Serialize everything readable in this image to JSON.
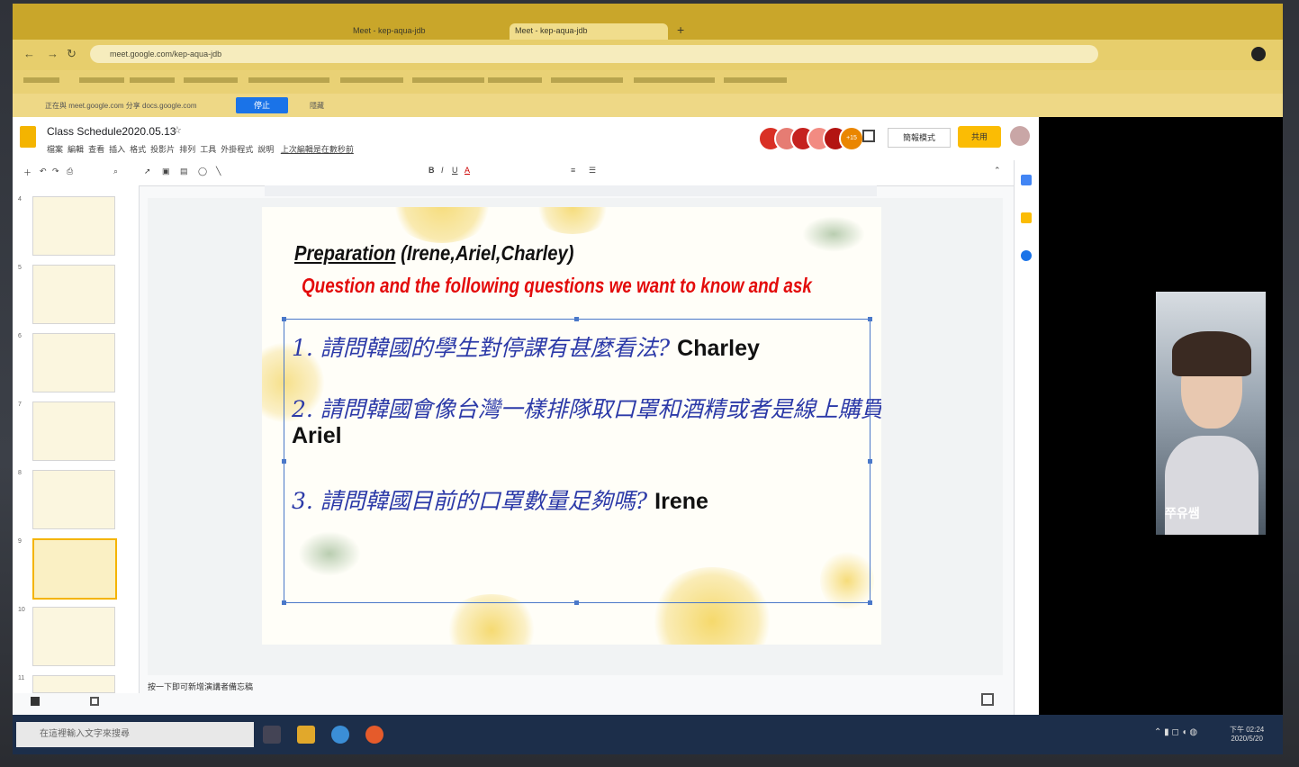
{
  "browser": {
    "tabs": [
      "Meet - kep-aqua-jdb",
      "Meet - kep-aqua-jdb"
    ],
    "url": "meet.google.com/kep-aqua-jdb"
  },
  "meet_bar": {
    "message": "正在與 meet.google.com 分享 docs.google.com",
    "stop_label": "停止",
    "hide_label": "隱藏"
  },
  "docs": {
    "title": "Class Schedule2020.05.13",
    "menu": [
      "檔案",
      "編輯",
      "查看",
      "插入",
      "格式",
      "投影片",
      "排列",
      "工具",
      "外掛程式",
      "說明"
    ],
    "last_edit": "上次編輯是在數秒前",
    "share_label": "共用",
    "present_label": "簡報模式",
    "collab_count": "+15",
    "notes": "按一下即可新增演講者備忘稿"
  },
  "slide_numbers": [
    "4",
    "5",
    "6",
    "7",
    "8",
    "9",
    "10",
    "11"
  ],
  "slide": {
    "title_underlined": "Preparation",
    "title_rest": " (Irene,Ariel,Charley)",
    "subtitle": "Question and the following questions we want to know and ask",
    "questions": [
      {
        "text": "1. 請問韓國的學生對停課有甚麼看法?",
        "who": "Charley"
      },
      {
        "text": "2. 請問韓國會像台灣一樣排隊取口罩和酒精或者是線上購買嗎?",
        "who": "Ariel"
      },
      {
        "text": "3. 請問韓國目前的口罩數量足夠嗎?",
        "who": "Irene"
      }
    ]
  },
  "video": {
    "participant_name": "쭈유쌤"
  },
  "taskbar": {
    "search_placeholder": "在這裡輸入文字來搜尋",
    "time": "下午 02:24",
    "date": "2020/5/20"
  }
}
